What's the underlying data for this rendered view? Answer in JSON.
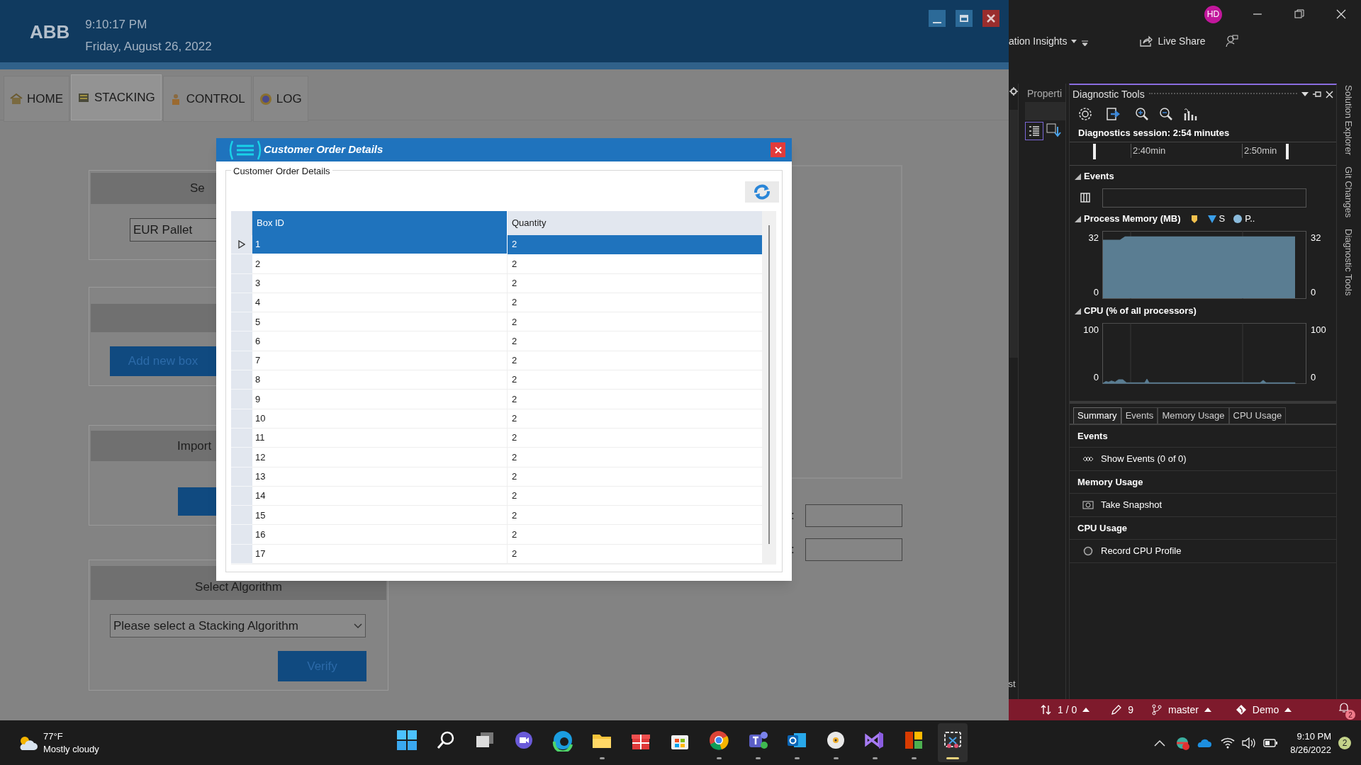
{
  "app": {
    "logo": "ABB",
    "time": "9:10:17 PM",
    "date": "Friday, August 26, 2022",
    "tabs": [
      {
        "label": "HOME",
        "selected": false
      },
      {
        "label": "STACKING",
        "selected": true
      },
      {
        "label": "CONTROL",
        "selected": false
      },
      {
        "label": "LOG",
        "selected": false
      }
    ],
    "panels": [
      {
        "heading": "Se",
        "field": "EUR Pallet"
      },
      {
        "button": "Add new box"
      },
      {
        "heading": "Import",
        "blank_button": true
      },
      {
        "heading": "Select Algorithm",
        "dropdown": "Please select a Stacking Algorithm",
        "button": "Verify"
      }
    ],
    "fields": [
      {
        "label": ":"
      },
      {
        "label": ":"
      }
    ]
  },
  "dialog": {
    "title": "Customer Order Details",
    "group_title": "Customer Order Details",
    "columns": [
      "Box ID",
      "Quantity"
    ],
    "rows": [
      {
        "box_id": "1",
        "quantity": "2",
        "selected": true
      },
      {
        "box_id": "2",
        "quantity": "2",
        "selected": false
      },
      {
        "box_id": "3",
        "quantity": "2",
        "selected": false
      },
      {
        "box_id": "4",
        "quantity": "2",
        "selected": false
      },
      {
        "box_id": "5",
        "quantity": "2",
        "selected": false
      },
      {
        "box_id": "6",
        "quantity": "2",
        "selected": false
      },
      {
        "box_id": "7",
        "quantity": "2",
        "selected": false
      },
      {
        "box_id": "8",
        "quantity": "2",
        "selected": false
      },
      {
        "box_id": "9",
        "quantity": "2",
        "selected": false
      },
      {
        "box_id": "10",
        "quantity": "2",
        "selected": false
      },
      {
        "box_id": "11",
        "quantity": "2",
        "selected": false
      },
      {
        "box_id": "12",
        "quantity": "2",
        "selected": false
      },
      {
        "box_id": "13",
        "quantity": "2",
        "selected": false
      },
      {
        "box_id": "14",
        "quantity": "2",
        "selected": false
      },
      {
        "box_id": "15",
        "quantity": "2",
        "selected": false
      },
      {
        "box_id": "16",
        "quantity": "2",
        "selected": false
      },
      {
        "box_id": "17",
        "quantity": "2",
        "selected": false
      }
    ]
  },
  "ide": {
    "menu": "ation Insights",
    "account": "HD",
    "live_share": "Live Share",
    "side_panel": "Properti",
    "strip_text": "st",
    "tool_window": {
      "title": "Diagnostic Tools",
      "session": "Diagnostics session: 2:54 minutes",
      "timeline": [
        "2:40min",
        "2:50min"
      ],
      "events_heading": "Events",
      "memory": {
        "heading": "Process Memory (MB)",
        "legend": [
          {
            "kind": "marker",
            "color": "#f2c14e"
          },
          {
            "kind": "triangle",
            "label": "S",
            "color": "#3a9ee8"
          },
          {
            "kind": "circle",
            "label": "P..",
            "color": "#8bbbdc"
          }
        ],
        "left_max": "32",
        "left_min": "0",
        "right_max": "32",
        "right_min": "0"
      },
      "cpu": {
        "heading": "CPU (% of all processors)",
        "left_max": "100",
        "left_min": "0",
        "right_max": "100",
        "right_min": "0"
      },
      "tabs": [
        {
          "label": "Summary",
          "selected": true
        },
        {
          "label": "Events",
          "selected": false
        },
        {
          "label": "Memory Usage",
          "selected": false
        },
        {
          "label": "CPU Usage",
          "selected": false
        }
      ],
      "sections": [
        {
          "heading": "Events",
          "action": "Show Events (0 of 0)",
          "kind": "events"
        },
        {
          "heading": "Memory Usage",
          "action": "Take Snapshot",
          "kind": "snapshot"
        },
        {
          "heading": "CPU Usage",
          "action": "Record CPU Profile",
          "kind": "record"
        }
      ]
    },
    "side_tabs": [
      "Solution Explorer",
      "Git Changes",
      "Diagnostic Tools"
    ],
    "status_bar": [
      {
        "kind": "sync",
        "text": "1 / 0"
      },
      {
        "kind": "edit",
        "text": "9"
      },
      {
        "kind": "branch",
        "text": "master"
      },
      {
        "kind": "repo",
        "text": "Demo"
      }
    ],
    "notifications": "2"
  },
  "taskbar": {
    "weather": {
      "temp": "77°F",
      "condition": "Mostly cloudy"
    },
    "apps": [
      {
        "kind": "start",
        "running": false,
        "selected": false
      },
      {
        "kind": "search",
        "running": false,
        "selected": false
      },
      {
        "kind": "taskview",
        "running": false,
        "selected": false
      },
      {
        "kind": "chat",
        "running": false,
        "selected": false
      },
      {
        "kind": "edge",
        "running": false,
        "selected": false
      },
      {
        "kind": "folder",
        "running": true,
        "selected": false
      },
      {
        "kind": "gift",
        "running": false,
        "selected": false
      },
      {
        "kind": "store",
        "running": false,
        "selected": false
      },
      {
        "kind": "chrome",
        "running": true,
        "selected": false
      },
      {
        "kind": "teams",
        "running": true,
        "selected": false
      },
      {
        "kind": "mail",
        "running": true,
        "selected": false
      },
      {
        "kind": "disc",
        "running": true,
        "selected": false
      },
      {
        "kind": "vs",
        "running": true,
        "selected": false
      },
      {
        "kind": "ribbon",
        "running": true,
        "selected": false
      },
      {
        "kind": "snip",
        "running": true,
        "selected": true
      }
    ],
    "time": "9:10 PM",
    "date": "8/26/2022",
    "badge": "2"
  }
}
